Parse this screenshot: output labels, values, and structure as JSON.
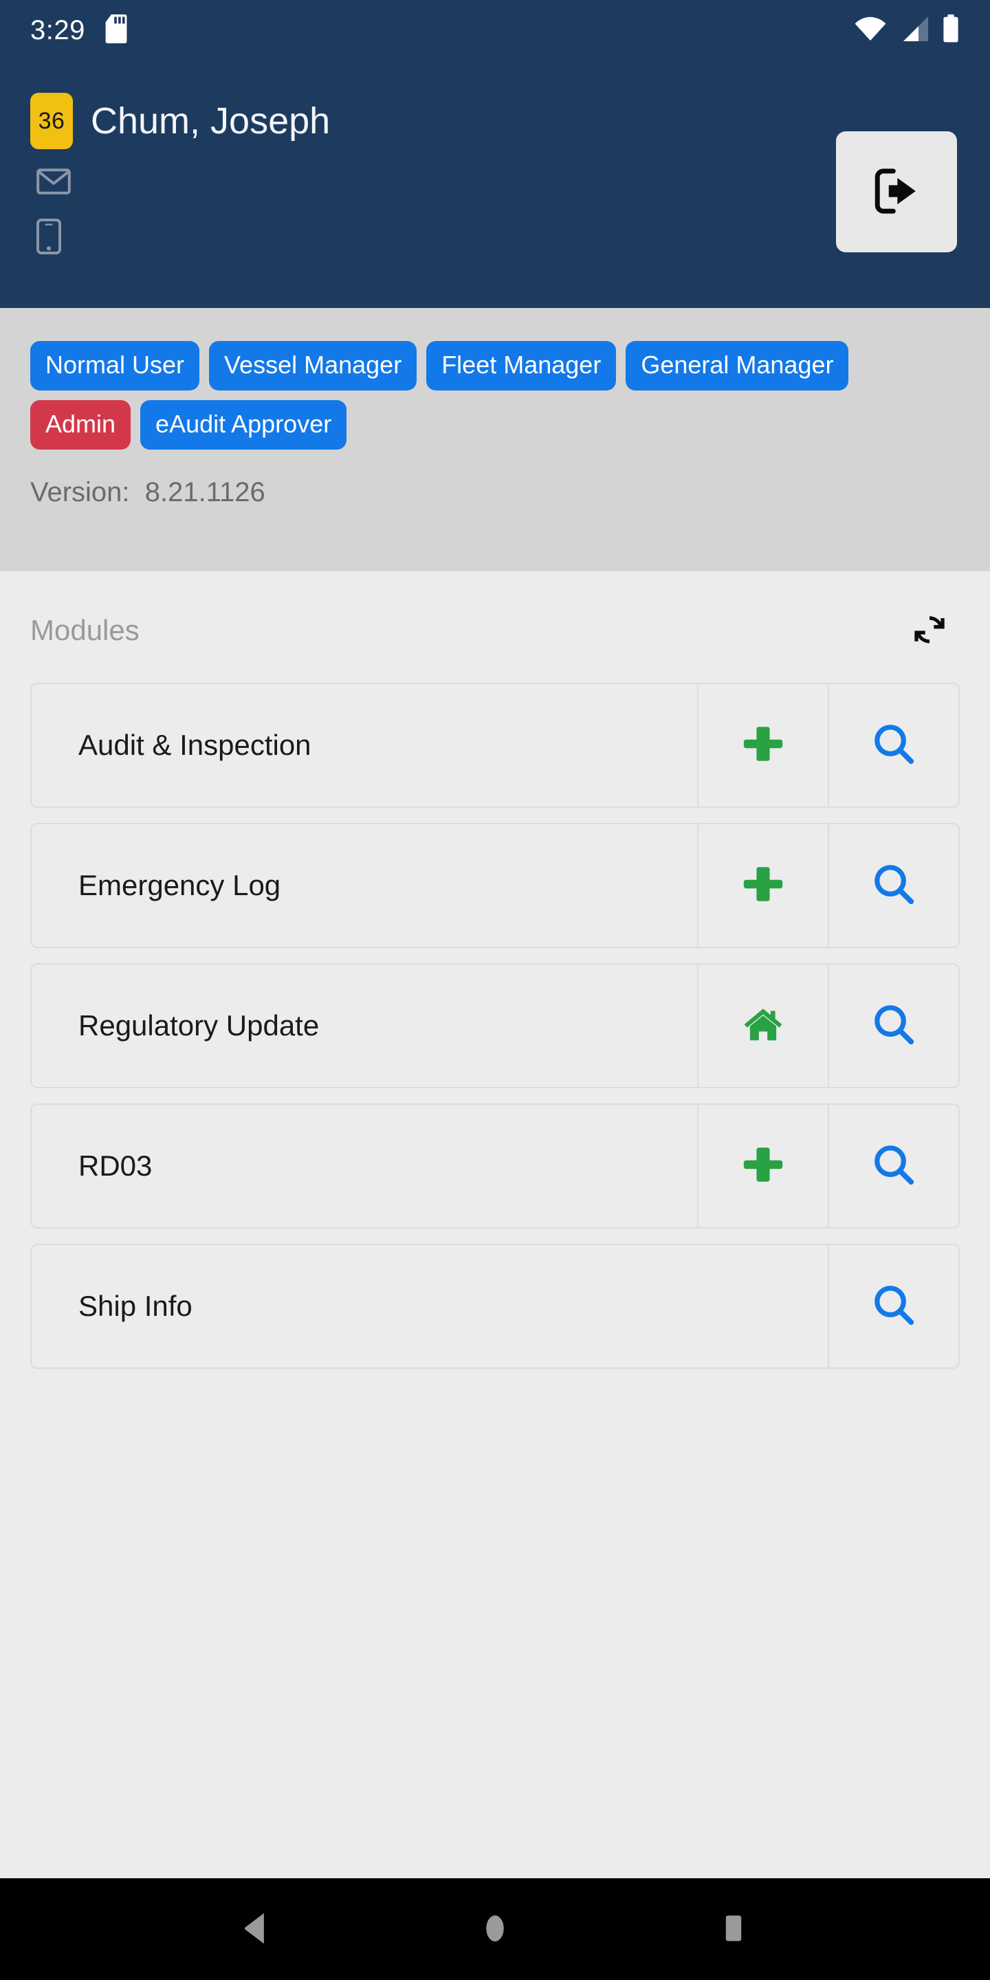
{
  "status_bar": {
    "time": "3:29",
    "icons": [
      "sd-card-icon",
      "wifi-icon",
      "cell-signal-icon",
      "battery-icon"
    ]
  },
  "header": {
    "badge_count": "36",
    "user_name": "Chum, Joseph",
    "email_icon": "envelope-icon",
    "mobile_icon": "mobile-phone-icon",
    "logout_icon": "logout-icon",
    "background_color": "#1d3b5f"
  },
  "roles": {
    "items": [
      {
        "label": "Normal User",
        "color": "#1379e8",
        "style": "blue"
      },
      {
        "label": "Vessel Manager",
        "color": "#1379e8",
        "style": "blue"
      },
      {
        "label": "Fleet Manager",
        "color": "#1379e8",
        "style": "blue"
      },
      {
        "label": "General Manager",
        "color": "#1379e8",
        "style": "blue"
      },
      {
        "label": "Admin",
        "color": "#d3384a",
        "style": "red"
      },
      {
        "label": "eAudit Approver",
        "color": "#1379e8",
        "style": "blue"
      }
    ],
    "version_label": "Version:  8.21.1126"
  },
  "modules": {
    "title": "Modules",
    "refresh_icon": "refresh-icon",
    "items": [
      {
        "label": "Audit & Inspection",
        "primary_icon": "plus-icon",
        "search_icon": "search-icon"
      },
      {
        "label": "Emergency Log",
        "primary_icon": "plus-icon",
        "search_icon": "search-icon"
      },
      {
        "label": "Regulatory Update",
        "primary_icon": "home-icon",
        "search_icon": "search-icon"
      },
      {
        "label": "RD03",
        "primary_icon": "plus-icon",
        "search_icon": "search-icon"
      },
      {
        "label": "Ship Info",
        "primary_icon": null,
        "search_icon": "search-icon"
      }
    ],
    "accent_add": "#29a243",
    "accent_search": "#1379e8"
  },
  "navbar": {
    "back_label": "back-button",
    "home_label": "home-button",
    "recents_label": "recents-button"
  }
}
